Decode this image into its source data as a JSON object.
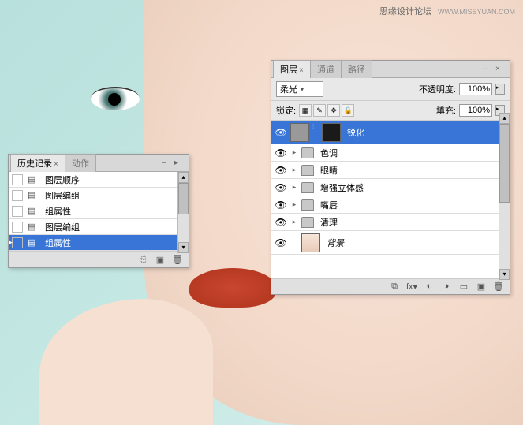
{
  "watermark": {
    "text": "思缘设计论坛",
    "url": "WWW.MISSYUAN.COM"
  },
  "history_panel": {
    "tabs": [
      {
        "label": "历史记录",
        "active": true
      },
      {
        "label": "动作",
        "active": false
      }
    ],
    "items": [
      {
        "label": "图层顺序",
        "selected": false
      },
      {
        "label": "图层编组",
        "selected": false
      },
      {
        "label": "组属性",
        "selected": false
      },
      {
        "label": "图层编组",
        "selected": false
      },
      {
        "label": "组属性",
        "selected": true
      }
    ]
  },
  "layers_panel": {
    "tabs": [
      {
        "label": "图层",
        "active": true
      },
      {
        "label": "通道",
        "active": false
      },
      {
        "label": "路径",
        "active": false
      }
    ],
    "blend_mode": "柔光",
    "opacity_label": "不透明度:",
    "opacity_value": "100%",
    "lock_label": "锁定:",
    "fill_label": "填充:",
    "fill_value": "100%",
    "layers": [
      {
        "name": "锐化",
        "type": "layer",
        "selected": true,
        "visible": true
      },
      {
        "name": "色调",
        "type": "group",
        "selected": false,
        "visible": true
      },
      {
        "name": "眼睛",
        "type": "group",
        "selected": false,
        "visible": true
      },
      {
        "name": "增强立体感",
        "type": "group",
        "selected": false,
        "visible": true
      },
      {
        "name": "嘴唇",
        "type": "group",
        "selected": false,
        "visible": true
      },
      {
        "name": "清理",
        "type": "group",
        "selected": false,
        "visible": true
      },
      {
        "name": "背景",
        "type": "background",
        "selected": false,
        "visible": true,
        "locked": true
      }
    ]
  }
}
